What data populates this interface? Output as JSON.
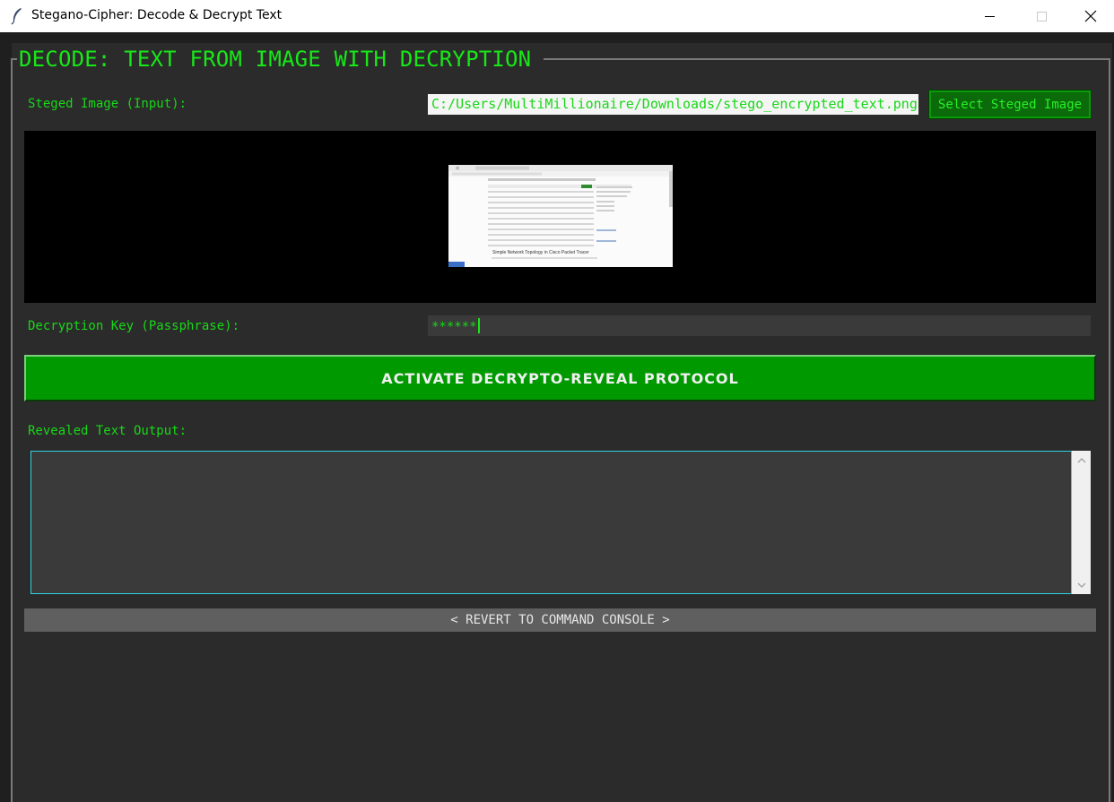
{
  "window": {
    "title": "Stegano-Cipher: Decode & Decrypt Text",
    "close_glyph": "✕"
  },
  "section": {
    "title": "DECODE: TEXT FROM IMAGE WITH DECRYPTION"
  },
  "input_image": {
    "label": "Steged Image (Input):",
    "path": "C:/Users/MultiMillionaire/Downloads/stego_encrypted_text.png",
    "select_button": "Select Steged Image"
  },
  "thumbnail": {
    "heading": "Simple Network Topology in Cisco Packet Tracer"
  },
  "key": {
    "label": "Decryption Key (Passphrase):",
    "masked_value": "******"
  },
  "actions": {
    "activate_label": "ACTIVATE DECRYPTO-REVEAL PROTOCOL",
    "revert_label": "< REVERT TO COMMAND CONSOLE >"
  },
  "output": {
    "label": "Revealed Text Output:",
    "text": ""
  },
  "colors": {
    "accent_green": "#18e818",
    "button_green": "#009a00",
    "output_border": "#2fd4e0",
    "background": "#2b2b2b"
  },
  "icons": {
    "app": "feather-icon",
    "minimize": "minimize-icon",
    "maximize": "maximize-icon",
    "close": "close-icon"
  }
}
